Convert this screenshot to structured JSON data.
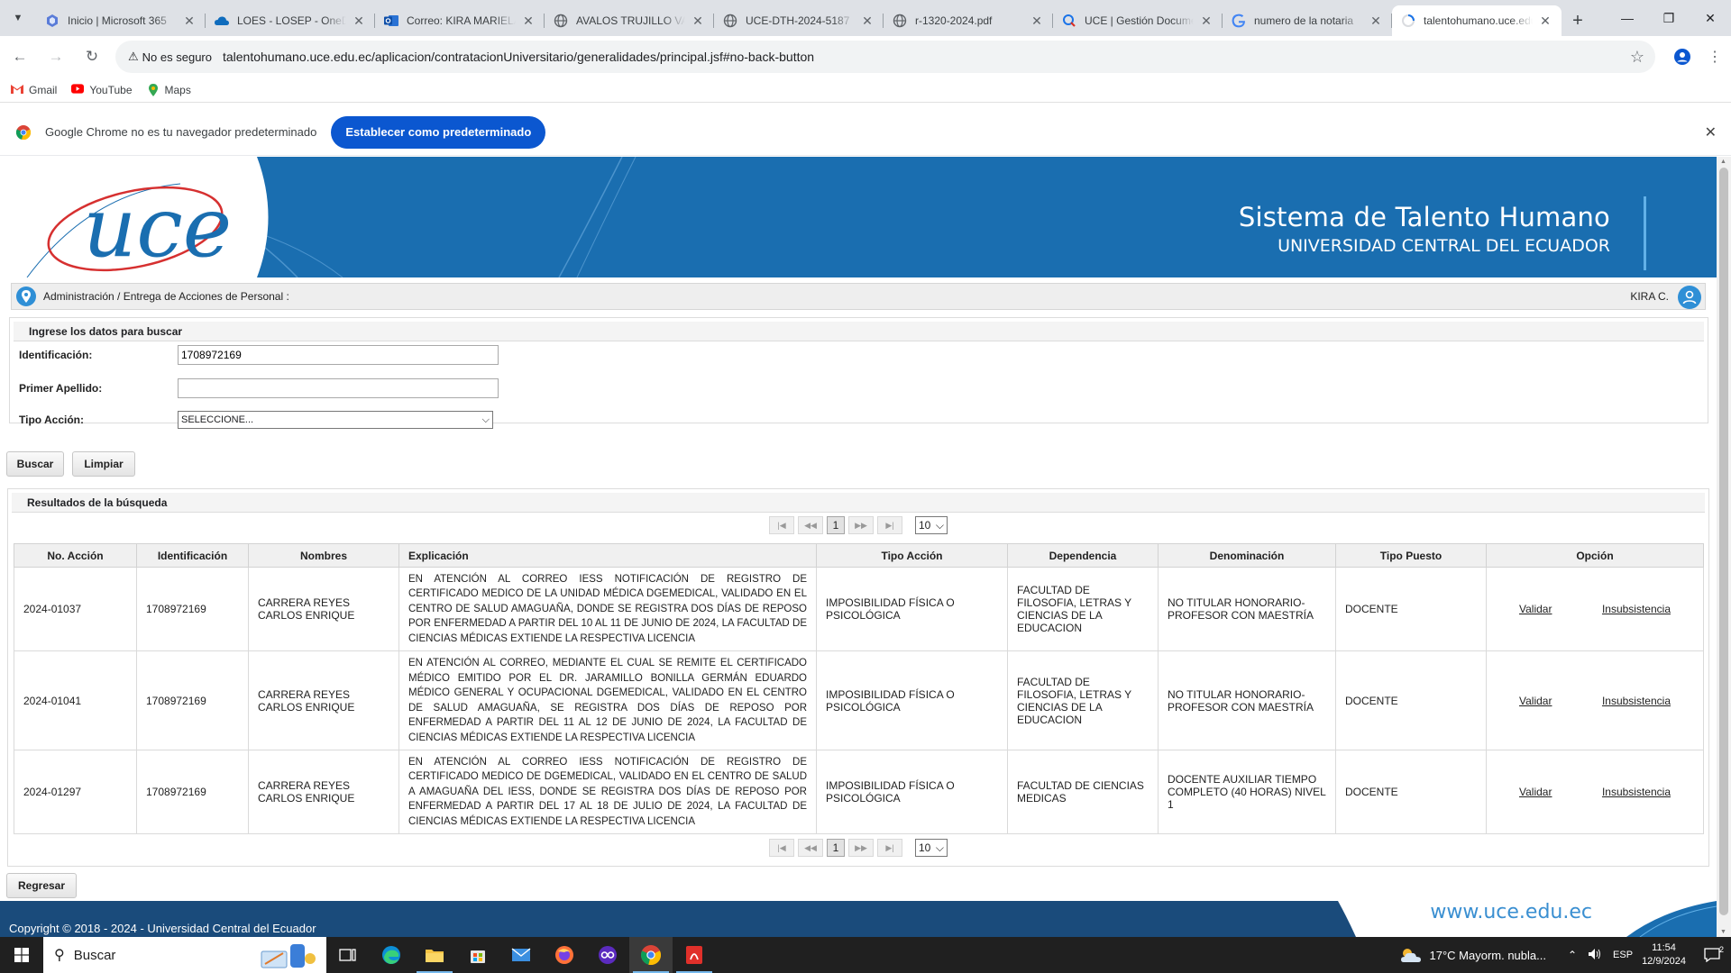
{
  "browser": {
    "tabs": [
      {
        "title": "Inicio | Microsoft 365",
        "icon": "m365-icon"
      },
      {
        "title": "LOES - LOSEP - OneDrive",
        "icon": "onedrive-icon"
      },
      {
        "title": "Correo: KIRA MARIELA",
        "icon": "outlook-icon"
      },
      {
        "title": "AVALOS TRUJILLO VALERIA",
        "icon": "globe-icon"
      },
      {
        "title": "UCE-DTH-2024-5187",
        "icon": "globe-icon"
      },
      {
        "title": "r-1320-2024.pdf",
        "icon": "globe-icon"
      },
      {
        "title": "UCE | Gestión Documental",
        "icon": "quipux-icon"
      },
      {
        "title": "numero de la notaria",
        "icon": "google-icon"
      },
      {
        "title": "talentohumano.uce.edu.ec",
        "icon": "loading-icon"
      }
    ],
    "security_label": "No es seguro",
    "url": "talentohumano.uce.edu.ec/aplicacion/contratacionUniversitario/generalidades/principal.jsf#no-back-button",
    "bookmarks": [
      "Gmail",
      "YouTube",
      "Maps"
    ],
    "infobar": {
      "message": "Google Chrome no es tu navegador predeterminado",
      "button": "Establecer como predeterminado"
    }
  },
  "header": {
    "title": "Sistema de Talento Humano",
    "subtitle": "UNIVERSIDAD CENTRAL DEL ECUADOR",
    "colors": {
      "banner": "#1a6eb0",
      "footer": "#1a4b7b"
    }
  },
  "breadcrumb": "Administración / Entrega de Acciones de Personal :",
  "user": "KIRA C.",
  "search": {
    "heading": "Ingrese los datos para buscar",
    "id_label": "Identificación:",
    "id_value": "1708972169",
    "surname_label": "Primer Apellido:",
    "surname_value": "",
    "action_label": "Tipo Acción:",
    "action_value": "SELECCIONE...",
    "search_button": "Buscar",
    "clear_button": "Limpiar"
  },
  "results": {
    "heading": "Resultados de la búsqueda",
    "page": "1",
    "page_size": "10",
    "columns": [
      "No. Acción",
      "Identificación",
      "Nombres",
      "Explicación",
      "Tipo Acción",
      "Dependencia",
      "Denominación",
      "Tipo Puesto",
      "Opción"
    ],
    "validate_label": "Validar",
    "void_label": "Insubsistencia",
    "rows": [
      {
        "no": "2024-01037",
        "id": "1708972169",
        "name": "CARRERA REYES CARLOS ENRIQUE",
        "explanation": "EN ATENCIÓN AL CORREO IESS NOTIFICACIÓN DE REGISTRO DE CERTIFICADO MEDICO DE LA UNIDAD MÉDICA DGEMEDICAL, VALIDADO EN EL CENTRO DE SALUD AMAGUAÑA, DONDE SE REGISTRA DOS DÍAS DE REPOSO POR ENFERMEDAD A PARTIR DEL 10 AL 11 DE JUNIO DE 2024, LA FACULTAD DE CIENCIAS MÉDICAS EXTIENDE LA RESPECTIVA LICENCIA",
        "action_type": "IMPOSIBILIDAD FÍSICA O PSICOLÓGICA",
        "dependency": "FACULTAD DE FILOSOFIA, LETRAS Y CIENCIAS DE LA EDUCACION",
        "denomination": "NO TITULAR HONORARIO-PROFESOR CON MAESTRÍA",
        "position_type": "DOCENTE"
      },
      {
        "no": "2024-01041",
        "id": "1708972169",
        "name": "CARRERA REYES CARLOS ENRIQUE",
        "explanation": "EN ATENCIÓN AL CORREO, MEDIANTE EL CUAL SE REMITE EL CERTIFICADO MÉDICO EMITIDO POR EL DR. JARAMILLO BONILLA GERMÁN EDUARDO MÉDICO GENERAL Y OCUPACIONAL DGEMEDICAL, VALIDADO EN EL CENTRO DE SALUD AMAGUAÑA, SE REGISTRA DOS DÍAS DE REPOSO POR ENFERMEDAD A PARTIR DEL 11 AL 12 DE JUNIO DE 2024, LA FACULTAD DE CIENCIAS MÉDICAS EXTIENDE LA RESPECTIVA LICENCIA",
        "action_type": "IMPOSIBILIDAD FÍSICA O PSICOLÓGICA",
        "dependency": "FACULTAD DE FILOSOFIA, LETRAS Y CIENCIAS DE LA EDUCACION",
        "denomination": "NO TITULAR HONORARIO-PROFESOR CON MAESTRÍA",
        "position_type": "DOCENTE"
      },
      {
        "no": "2024-01297",
        "id": "1708972169",
        "name": "CARRERA REYES CARLOS ENRIQUE",
        "explanation": "EN ATENCIÓN AL CORREO IESS NOTIFICACIÓN DE REGISTRO DE CERTIFICADO MEDICO DE DGEMEDICAL, VALIDADO EN EL CENTRO DE SALUD A AMAGUAÑA DEL IESS, DONDE SE REGISTRA DOS DÍAS DE REPOSO POR ENFERMEDAD A PARTIR DEL 17 AL 18 DE JULIO DE 2024, LA FACULTAD DE CIENCIAS MÉDICAS EXTIENDE LA RESPECTIVA LICENCIA",
        "action_type": "IMPOSIBILIDAD FÍSICA O PSICOLÓGICA",
        "dependency": "FACULTAD DE CIENCIAS MEDICAS",
        "denomination": "DOCENTE AUXILIAR TIEMPO COMPLETO (40 HORAS) NIVEL 1",
        "position_type": "DOCENTE"
      }
    ]
  },
  "back_button": "Regresar",
  "footer": {
    "copyright": "Copyright © 2018 - 2024 - Universidad Central del Ecuador",
    "website": "www.uce.edu.ec"
  },
  "taskbar": {
    "search_placeholder": "Buscar",
    "weather": "17°C  Mayorm. nubla...",
    "language": "ESP",
    "time": "11:54",
    "date": "12/9/2024",
    "notifications": "2"
  }
}
